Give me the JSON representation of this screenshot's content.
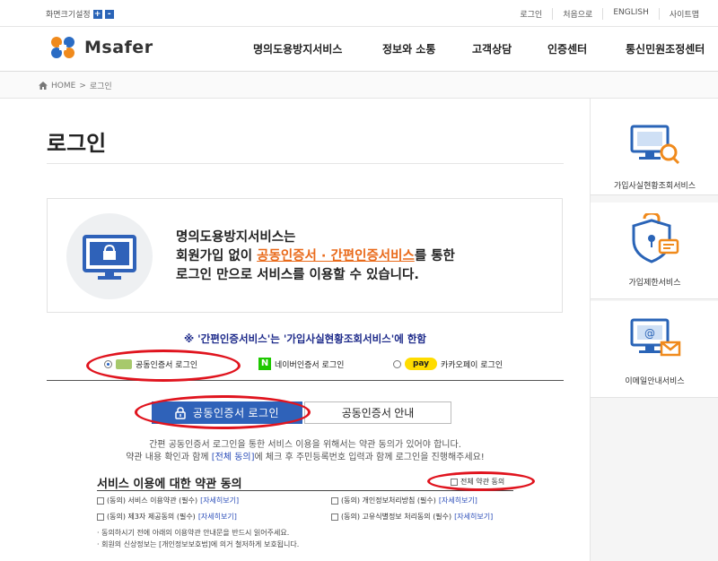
{
  "topbar": {
    "font_size_label": "화면크기설정",
    "font_plus": "+",
    "font_minus": "-",
    "util": [
      "로그인",
      "처음으로",
      "ENGLISH",
      "사이트맵"
    ]
  },
  "gnb": {
    "brand": "Msafer",
    "menu": [
      "명의도용방지서비스",
      "정보와 소통",
      "고객상담",
      "인증센터",
      "통신민원조정센터"
    ]
  },
  "breadcrumb": {
    "home": "HOME",
    "sep": ">",
    "current": "로그인"
  },
  "page_title": "로그인",
  "intro": {
    "line1": "명의도용방지서비스는",
    "line2_pre": "회원가입 없이 ",
    "line2_hl": "공동인증서 · 간편인증서비스",
    "line2_post": "를 통한",
    "line3": "로그인 만으로 서비스를 이용할 수 있습니다."
  },
  "notice": "※ '간편인증서비스'는 '가입사실현황조회서비스'에 한함",
  "login_tabs": [
    {
      "label": "공동인증서 로그인",
      "selected": true
    },
    {
      "label": "네이버인증서 로그인",
      "selected": false
    },
    {
      "label": "카카오페이 로그인",
      "selected": false,
      "badge": "pay"
    }
  ],
  "naver_badge": "N",
  "buttons": {
    "cert_login": "공동인증서 로그인",
    "cert_guide": "공동인증서 안내"
  },
  "desc": {
    "line1": "간편 공동인증서 로그인을 통한 서비스 이용을 위해서는 약관 동의가 있어야 합니다.",
    "line2_pre": "약관 내용 확인과 함께 ",
    "line2_link": "[전체 동의]",
    "line2_post": "에 체크 후 주민등록번호 입력과 함께 로그인을 진행해주세요!"
  },
  "agreement": {
    "title": "서비스 이용에 대한 약관 동의",
    "all": "전체 약관 동의",
    "items": [
      {
        "label": "(동의) 서비스 이용약관 (필수)",
        "detail": "[자세히보기]"
      },
      {
        "label": "(동의) 개인정보처리방침 (필수)",
        "detail": "[자세히보기]"
      },
      {
        "label": "(동의) 제3자 제공동의 (필수)",
        "detail": "[자세히보기]"
      },
      {
        "label": "(동의) 고유식별정보 처리동의 (필수)",
        "detail": "[자세히보기]"
      }
    ],
    "note1": "· 동의하시기 전에 아래의 이용약관 안내문을 반드시 읽어주세요.",
    "note2": "· 회원의 신상정보는 [개인정보보호법]에 의거 철저하게 보호됩니다."
  },
  "side": [
    {
      "label": "가입사실현황조회서비스",
      "icon": "monitor-search-icon"
    },
    {
      "label": "가입제한서비스",
      "icon": "shield-lock-icon"
    },
    {
      "label": "이메일안내서비스",
      "icon": "monitor-mail-icon"
    }
  ],
  "colors": {
    "accent_blue": "#2f62b9",
    "highlight_orange": "#e96a1a",
    "ring_red": "#e0141e",
    "notice_navy": "#1d2a8a"
  }
}
